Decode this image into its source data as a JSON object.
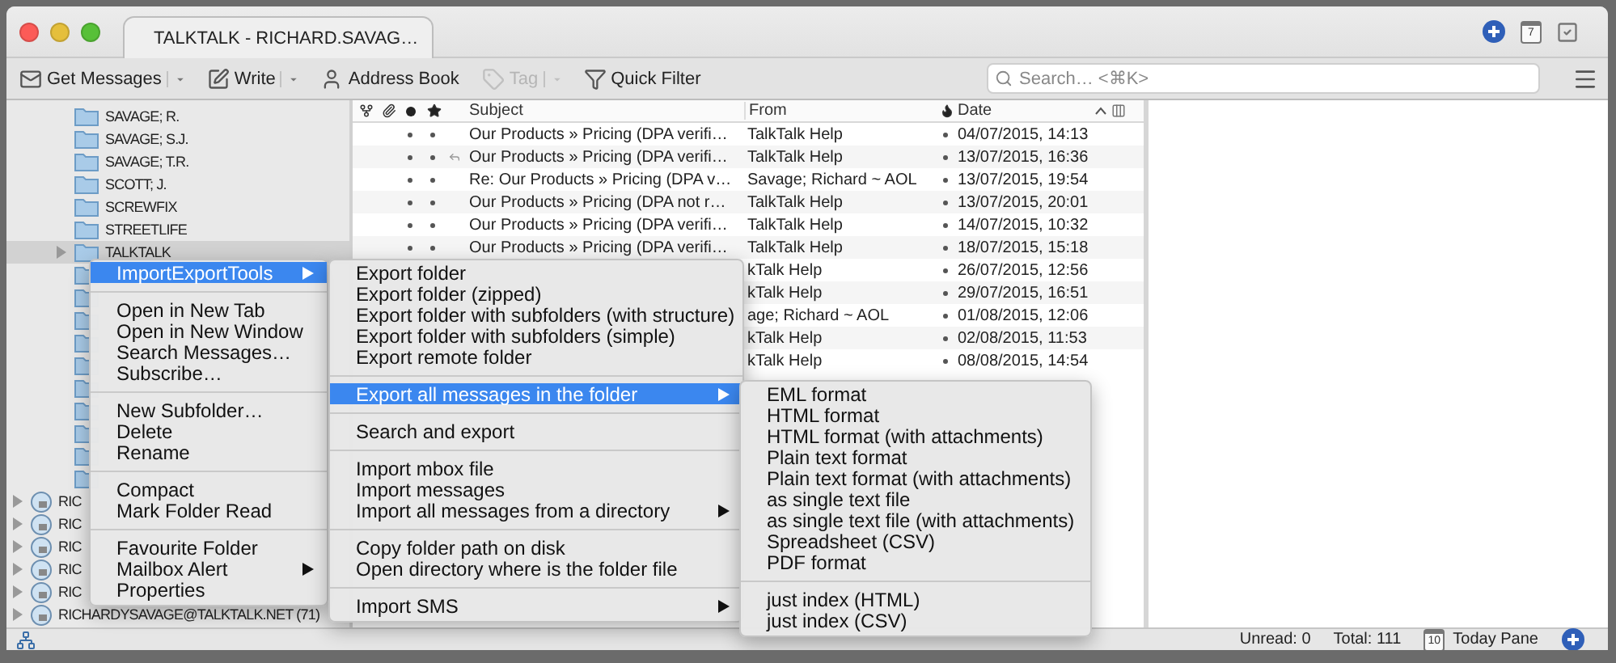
{
  "tab": {
    "title": "TALKTALK - RICHARD.SAVAG…",
    "selected": true
  },
  "title_icons": {
    "calendar_day": "7"
  },
  "toolbar": {
    "buttons": [
      {
        "label": "Get Messages",
        "dropdown": true,
        "disabled": false
      },
      {
        "label": "Write",
        "dropdown": true,
        "disabled": false
      },
      {
        "label": "Address Book",
        "dropdown": false,
        "disabled": false
      },
      {
        "label": "Tag",
        "dropdown": true,
        "disabled": true
      },
      {
        "label": "Quick Filter",
        "dropdown": false,
        "disabled": false
      }
    ],
    "search": {
      "placeholder": "Search… <⌘K>"
    }
  },
  "folders": [
    {
      "kind": "folder",
      "label": "SAVAGE; R.",
      "selected": false
    },
    {
      "kind": "folder",
      "label": "SAVAGE; S.J.",
      "selected": false
    },
    {
      "kind": "folder",
      "label": "SAVAGE; T.R.",
      "selected": false
    },
    {
      "kind": "folder",
      "label": "SCOTT; J.",
      "selected": false
    },
    {
      "kind": "folder",
      "label": "SCREWFIX",
      "selected": false
    },
    {
      "kind": "folder",
      "label": "STREETLIFE",
      "selected": false
    },
    {
      "kind": "folder",
      "label": "TALKTALK",
      "selected": true,
      "expanded": false
    },
    {
      "kind": "folder",
      "selected": false
    },
    {
      "kind": "folder",
      "selected": false
    },
    {
      "kind": "folder",
      "selected": false
    },
    {
      "kind": "folder",
      "selected": false
    },
    {
      "kind": "folder",
      "selected": false
    },
    {
      "kind": "folder",
      "selected": false
    },
    {
      "kind": "folder",
      "selected": false
    },
    {
      "kind": "folder",
      "selected": false
    },
    {
      "kind": "folder",
      "selected": false
    },
    {
      "kind": "folder",
      "selected": false
    },
    {
      "kind": "account",
      "label": "RIC",
      "selected": false,
      "expanded": false
    },
    {
      "kind": "account",
      "label": "RIC",
      "selected": false,
      "expanded": false
    },
    {
      "kind": "account",
      "label": "RIC",
      "selected": false,
      "expanded": false
    },
    {
      "kind": "account",
      "label": "RIC",
      "selected": false,
      "expanded": false
    },
    {
      "kind": "account",
      "label": "RIC",
      "selected": false,
      "expanded": false
    },
    {
      "kind": "account",
      "label": "RICHARDYSAVAGE@TALKTALK.NET (71)",
      "selected": false,
      "expanded": false
    }
  ],
  "message_list": {
    "columns": {
      "subject": "Subject",
      "from": "From",
      "date": "Date"
    },
    "sort_ascending": true,
    "rows": [
      {
        "subject": "Our Products » Pricing (DPA verifi…",
        "from": "TalkTalk Help",
        "date": "04/07/2015, 14:13",
        "read": true,
        "starred": false,
        "replied": false,
        "junk": false
      },
      {
        "subject": "Our Products » Pricing (DPA verifi…",
        "from": "TalkTalk Help",
        "date": "13/07/2015, 16:36",
        "read": true,
        "starred": false,
        "replied": true,
        "junk": false
      },
      {
        "subject": "Re: Our Products » Pricing (DPA v…",
        "from": "Savage; Richard ~ AOL",
        "date": "13/07/2015, 19:54",
        "read": true,
        "starred": false,
        "replied": false,
        "junk": false
      },
      {
        "subject": "Our Products » Pricing (DPA not r…",
        "from": "TalkTalk Help",
        "date": "13/07/2015, 20:01",
        "read": true,
        "starred": false,
        "replied": false,
        "junk": false
      },
      {
        "subject": "Our Products » Pricing (DPA verifi…",
        "from": "TalkTalk Help",
        "date": "14/07/2015, 10:32",
        "read": true,
        "starred": false,
        "replied": false,
        "junk": false
      },
      {
        "subject": "Our Products » Pricing (DPA verifi…",
        "from": "TalkTalk Help",
        "date": "18/07/2015, 15:18",
        "read": true,
        "starred": false,
        "replied": false,
        "junk": false
      },
      {
        "from": "kTalk Help",
        "date": "26/07/2015, 12:56",
        "junk": false
      },
      {
        "from": "kTalk Help",
        "date": "29/07/2015, 16:51",
        "junk": false
      },
      {
        "from": "age; Richard ~ AOL",
        "date": "01/08/2015, 12:06",
        "junk": false
      },
      {
        "from": "kTalk Help",
        "date": "02/08/2015, 11:53",
        "junk": false
      },
      {
        "from": "kTalk Help",
        "date": "08/08/2015, 14:54",
        "junk": false
      }
    ]
  },
  "menus": [
    {
      "items": [
        {
          "kind": "item",
          "label": "ImportExportTools",
          "selected": true,
          "submenu": true
        },
        {
          "kind": "separator"
        },
        {
          "kind": "item",
          "label": "Open in New Tab",
          "selected": false,
          "submenu": false
        },
        {
          "kind": "item",
          "label": "Open in New Window",
          "selected": false,
          "submenu": false
        },
        {
          "kind": "item",
          "label": "Search Messages…",
          "selected": false,
          "submenu": false
        },
        {
          "kind": "item",
          "label": "Subscribe…",
          "selected": false,
          "submenu": false
        },
        {
          "kind": "separator"
        },
        {
          "kind": "item",
          "label": "New Subfolder…",
          "selected": false,
          "submenu": false
        },
        {
          "kind": "item",
          "label": "Delete",
          "selected": false,
          "submenu": false
        },
        {
          "kind": "item",
          "label": "Rename",
          "selected": false,
          "submenu": false
        },
        {
          "kind": "separator"
        },
        {
          "kind": "item",
          "label": "Compact",
          "selected": false,
          "submenu": false
        },
        {
          "kind": "item",
          "label": "Mark Folder Read",
          "selected": false,
          "submenu": false
        },
        {
          "kind": "separator"
        },
        {
          "kind": "item",
          "label": "Favourite Folder",
          "selected": false,
          "submenu": false
        },
        {
          "kind": "item",
          "label": "Mailbox Alert",
          "selected": false,
          "submenu": true
        },
        {
          "kind": "item",
          "label": "Properties",
          "selected": false,
          "submenu": false
        }
      ]
    },
    {
      "items": [
        {
          "kind": "item",
          "label": "Export folder",
          "selected": false,
          "submenu": false
        },
        {
          "kind": "item",
          "label": "Export folder (zipped)",
          "selected": false,
          "submenu": false
        },
        {
          "kind": "item",
          "label": "Export folder with subfolders (with structure)",
          "selected": false,
          "submenu": false
        },
        {
          "kind": "item",
          "label": "Export folder with subfolders (simple)",
          "selected": false,
          "submenu": false
        },
        {
          "kind": "item",
          "label": "Export remote folder",
          "selected": false,
          "submenu": false
        },
        {
          "kind": "separator"
        },
        {
          "kind": "item",
          "label": "Export all messages in the folder",
          "selected": true,
          "submenu": true
        },
        {
          "kind": "separator"
        },
        {
          "kind": "item",
          "label": "Search and export",
          "selected": false,
          "submenu": false
        },
        {
          "kind": "separator"
        },
        {
          "kind": "item",
          "label": "Import mbox file",
          "selected": false,
          "submenu": false
        },
        {
          "kind": "item",
          "label": "Import messages",
          "selected": false,
          "submenu": false
        },
        {
          "kind": "item",
          "label": "Import all messages from a directory",
          "selected": false,
          "submenu": true
        },
        {
          "kind": "separator"
        },
        {
          "kind": "item",
          "label": "Copy folder path on disk",
          "selected": false,
          "submenu": false
        },
        {
          "kind": "item",
          "label": "Open directory where is the folder file",
          "selected": false,
          "submenu": false
        },
        {
          "kind": "separator"
        },
        {
          "kind": "item",
          "label": "Import SMS",
          "selected": false,
          "submenu": true
        }
      ]
    },
    {
      "items": [
        {
          "kind": "item",
          "label": "EML format",
          "selected": false,
          "submenu": false
        },
        {
          "kind": "item",
          "label": "HTML format",
          "selected": false,
          "submenu": false
        },
        {
          "kind": "item",
          "label": "HTML format (with attachments)",
          "selected": false,
          "submenu": false
        },
        {
          "kind": "item",
          "label": "Plain text format",
          "selected": false,
          "submenu": false
        },
        {
          "kind": "item",
          "label": "Plain text format (with attachments)",
          "selected": false,
          "submenu": false
        },
        {
          "kind": "item",
          "label": "as single text file",
          "selected": false,
          "submenu": false
        },
        {
          "kind": "item",
          "label": "as single text file (with attachments)",
          "selected": false,
          "submenu": false
        },
        {
          "kind": "item",
          "label": "Spreadsheet (CSV)",
          "selected": false,
          "submenu": false
        },
        {
          "kind": "item",
          "label": "PDF format",
          "selected": false,
          "submenu": false
        },
        {
          "kind": "separator"
        },
        {
          "kind": "item",
          "label": "just index (HTML)",
          "selected": false,
          "submenu": false
        },
        {
          "kind": "item",
          "label": "just index (CSV)",
          "selected": false,
          "submenu": false
        }
      ]
    }
  ],
  "status_bar": {
    "unread": "Unread: 0",
    "total": "Total: 111",
    "today_day": "10",
    "today_pane": "Today Pane"
  }
}
